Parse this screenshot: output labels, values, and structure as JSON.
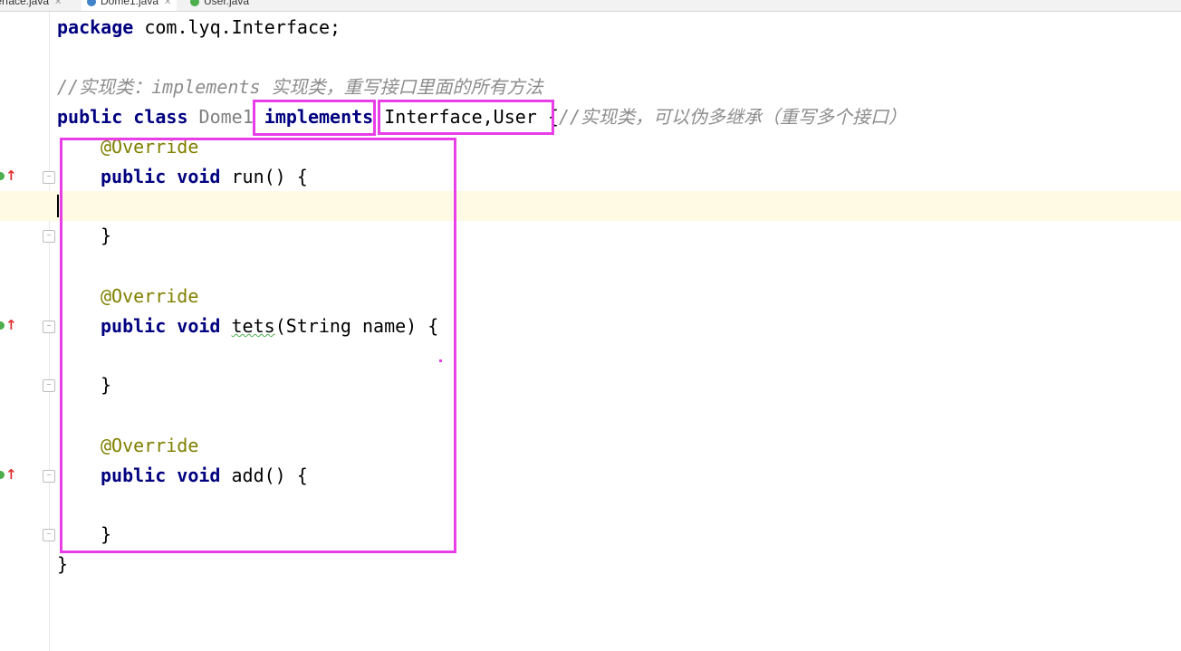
{
  "tabs": [
    {
      "label": "terface.java",
      "icon": "interface-file-icon",
      "active": false
    },
    {
      "label": "Dome1.java",
      "icon": "class-file-icon",
      "active": true
    },
    {
      "label": "User.java",
      "icon": "interface-file-icon",
      "active": false
    }
  ],
  "colors": {
    "highlight_box": "#e83ee8",
    "keyword": "#000080",
    "annotation": "#808000",
    "comment": "#8c8c8c",
    "caret_line": "#fffae3"
  },
  "code": {
    "package_kw": "package",
    "package_name": " com.lyq.Interface;",
    "comment_line": "//实现类：implements 实现类，重写接口里面的所有方法",
    "class_public": "public",
    "class_kw": " class",
    "class_name": " Dome1",
    "implements_kw": "implements",
    "interfaces": "Interface,User {",
    "class_comment": "//实现类，可以伪多继承（重写多个接口）",
    "override": "@Override",
    "public_kw": "public",
    "void_kw": " void",
    "run_sig": " run() {",
    "tets_name": "tets",
    "tets_sig": "(String name) {",
    "add_sig": " add() {",
    "close_brace": "}",
    "class_close": "}"
  }
}
